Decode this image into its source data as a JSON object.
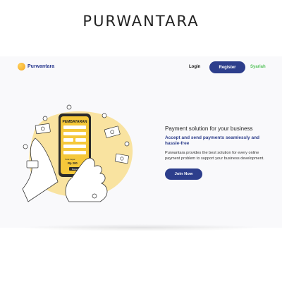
{
  "page_title": "PURWANTARA",
  "nav": {
    "logo_text": "Purwantara",
    "login_label": "Login",
    "register_label": "Register",
    "syariah_label": "Syariah"
  },
  "illustration": {
    "phone_header": "PEMBAYARAN",
    "total_label": "Total bayar",
    "total_value": "Rp 200",
    "pay_button": "Bayar"
  },
  "hero": {
    "headline": "Payment solution for your business",
    "subheadline": "Accept and send payments seamlessly and hassle-free",
    "description": "Purwantara provides the best solution for every online payment problem to support your business development.",
    "cta_label": "Join Now"
  },
  "colors": {
    "brand_navy": "#2d3e8c",
    "accent_yellow": "#f5c83a",
    "syariah_green": "#55c35a"
  }
}
